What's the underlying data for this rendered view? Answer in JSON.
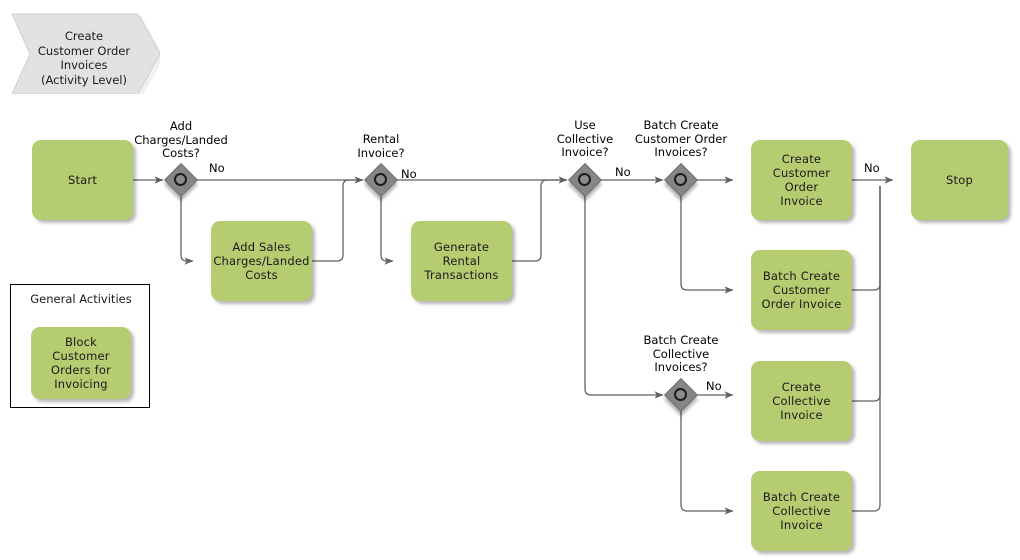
{
  "diagram": {
    "title": "Create\nCustomer Order\nInvoices\n(Activity Level)",
    "colors": {
      "task_fill": "#b5cd70",
      "banner_fill": "#e2e2e2",
      "gateway_fill": "#868686",
      "line": "#616161"
    }
  },
  "group": {
    "title": "General Activities",
    "task": "Block Customer\nOrders for\nInvoicing"
  },
  "tasks": {
    "start": "Start",
    "add_sales_charges": "Add Sales\nCharges/Landed\nCosts",
    "generate_rental": "Generate Rental\nTransactions",
    "create_customer_order_invoice": "Create\nCustomer Order\nInvoice",
    "batch_create_customer_order_invoice": "Batch Create\nCustomer\nOrder Invoice",
    "create_collective_invoice": "Create\nCollective\nInvoice",
    "batch_create_collective_invoice": "Batch Create\nCollective\nInvoice",
    "stop": "Stop"
  },
  "gateways": {
    "add_charges": "Add\nCharges/Landed\nCosts?",
    "rental_invoice": "Rental\nInvoice?",
    "use_collective": "Use\nCollective\nInvoice?",
    "batch_create_customer_order": "Batch Create\nCustomer Order\nInvoices?",
    "batch_create_collective": "Batch Create\nCollective\nInvoices?"
  },
  "edge_labels": {
    "add_charges_no": "No",
    "rental_invoice_no": "No",
    "use_collective_no": "No",
    "create_invoice_no": "No",
    "batch_collective_no": "No"
  }
}
